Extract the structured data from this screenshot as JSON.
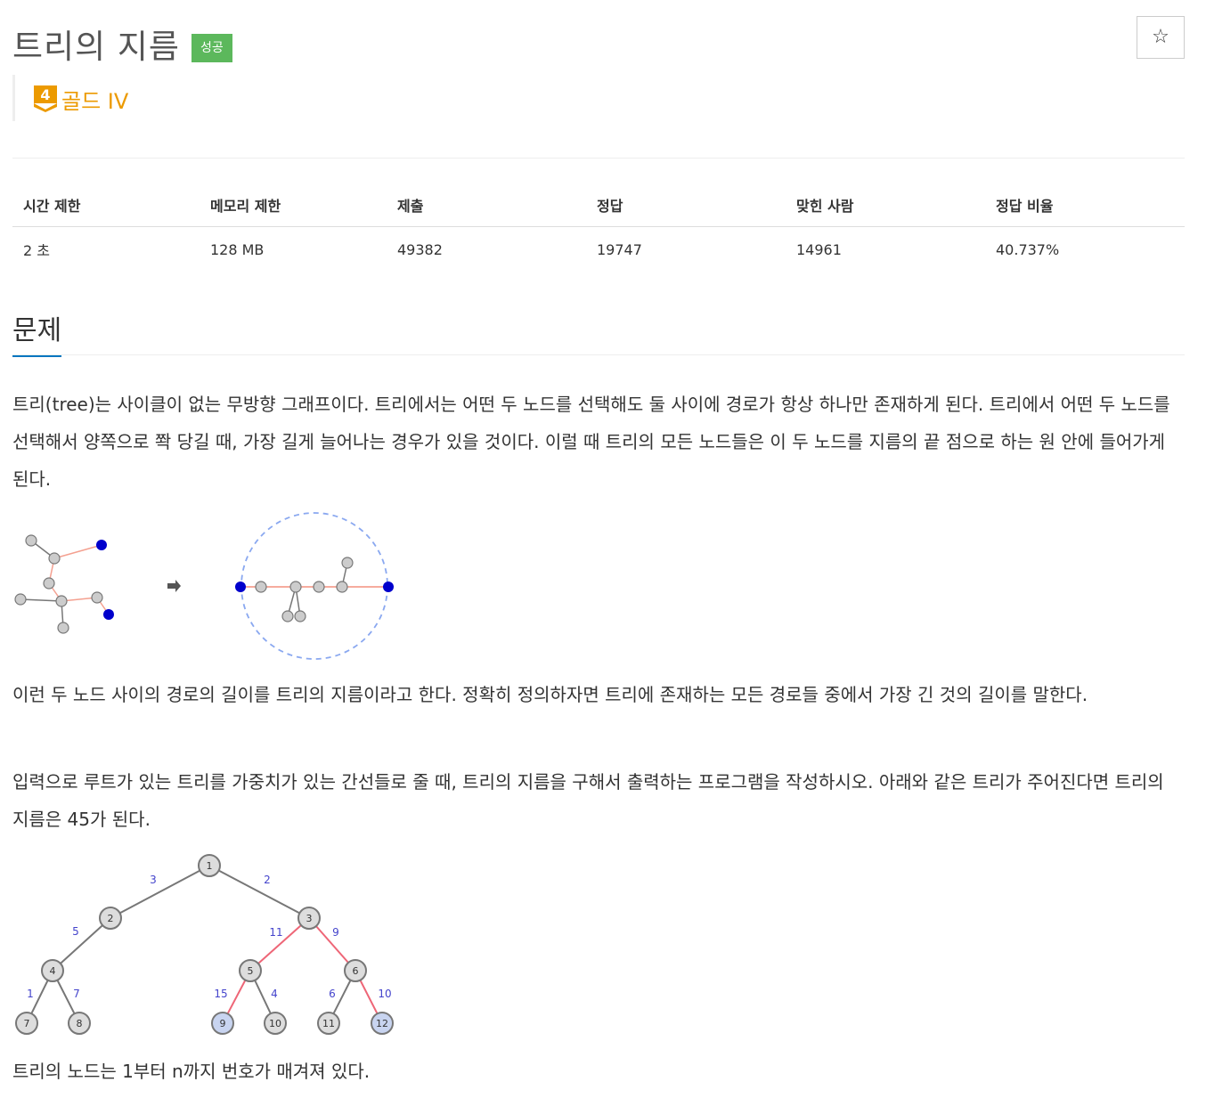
{
  "problem": {
    "title": "트리의 지름",
    "status_badge": "성공",
    "tier_number": "4",
    "tier_label": "골드 IV",
    "star_icon": "☆"
  },
  "info_table": {
    "headers": [
      "시간 제한",
      "메모리 제한",
      "제출",
      "정답",
      "맞힌 사람",
      "정답 비율"
    ],
    "values": [
      "2 초",
      "128 MB",
      "49382",
      "19747",
      "14961",
      "40.737%"
    ]
  },
  "section": {
    "title": "문제",
    "paragraph1": "트리(tree)는 사이클이 없는 무방향 그래프이다. 트리에서는 어떤 두 노드를 선택해도 둘 사이에 경로가 항상 하나만 존재하게 된다. 트리에서 어떤 두 노드를 선택해서 양쪽으로 쫙 당길 때, 가장 길게 늘어나는 경우가 있을 것이다. 이럴 때 트리의 모든 노드들은 이 두 노드를 지름의 끝 점으로 하는 원 안에 들어가게 된다.",
    "paragraph2": "이런 두 노드 사이의 경로의 길이를 트리의 지름이라고 한다. 정확히 정의하자면 트리에 존재하는 모든 경로들 중에서 가장 긴 것의 길이를 말한다.",
    "paragraph3": "입력으로 루트가 있는 트리를 가중치가 있는 간선들로 줄 때, 트리의 지름을 구해서 출력하는 프로그램을 작성하시오. 아래와 같은 트리가 주어진다면 트리의 지름은 45가 된다.",
    "paragraph4": "트리의 노드는 1부터 n까지 번호가 매겨져 있다."
  },
  "tree_figure": {
    "nodes": [
      "1",
      "2",
      "3",
      "4",
      "5",
      "6",
      "7",
      "8",
      "9",
      "10",
      "11",
      "12"
    ],
    "edge_weights": [
      "3",
      "2",
      "5",
      "11",
      "9",
      "1",
      "7",
      "15",
      "4",
      "6",
      "10"
    ]
  },
  "colors": {
    "badge": "#5cb85c",
    "tier": "#ec9a00",
    "accent": "#0076c0",
    "highlight_edge": "#ee6677",
    "endpoint_node": "#0000cc"
  }
}
